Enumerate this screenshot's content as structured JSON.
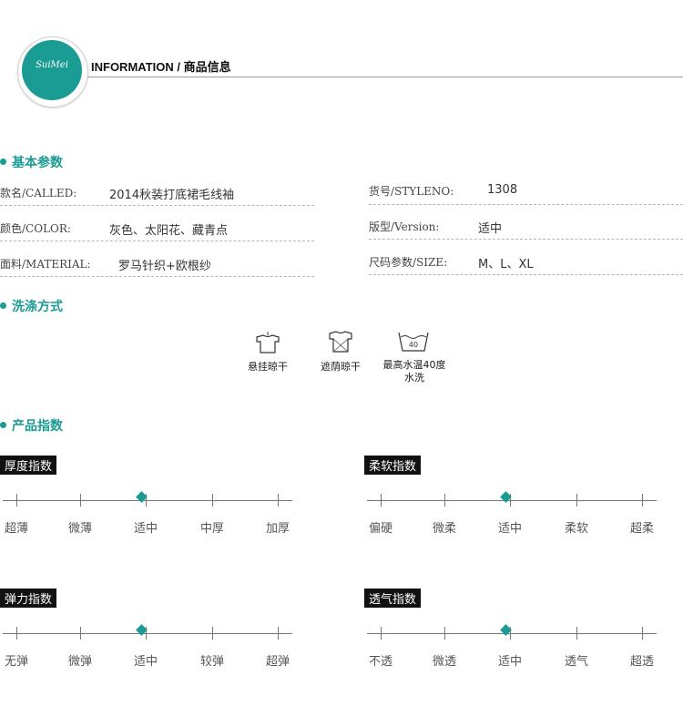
{
  "header": {
    "logo_text": "SuiMei",
    "title": "INFORMATION / 商品信息"
  },
  "sections": {
    "basic": "基本参数",
    "wash": "洗涤方式",
    "index": "产品指数"
  },
  "params": [
    {
      "label": "款名/CALLED:",
      "value": "2014秋装打底裙毛线袖"
    },
    {
      "label": "颜色/COLOR:",
      "value": "灰色、太阳花、藏青点"
    },
    {
      "label": "面料/MATERIAL:",
      "value": "罗马针织+欧根纱"
    },
    {
      "label": "货号/STYLENO:",
      "value": "1308"
    },
    {
      "label": "版型/Version:",
      "value": "适中"
    },
    {
      "label": "尺码参数/SIZE:",
      "value": "M、L、XL"
    }
  ],
  "wash": [
    {
      "icon": "hang-dry-icon",
      "label": "悬挂晾干"
    },
    {
      "icon": "shade-dry-icon",
      "label": "遮荫晾干"
    },
    {
      "icon": "wash-40-icon",
      "label": "最高水温40度\n水洗",
      "temp": "40"
    }
  ],
  "scales": [
    {
      "title": "厚度指数",
      "ticks": [
        "超薄",
        "微薄",
        "适中",
        "中厚",
        "加厚"
      ],
      "selected": 2
    },
    {
      "title": "柔软指数",
      "ticks": [
        "偏硬",
        "微柔",
        "适中",
        "柔软",
        "超柔"
      ],
      "selected": 2
    },
    {
      "title": "弹力指数",
      "ticks": [
        "无弹",
        "微弹",
        "适中",
        "较弹",
        "超弹"
      ],
      "selected": 2
    },
    {
      "title": "透气指数",
      "ticks": [
        "不透",
        "微透",
        "适中",
        "透气",
        "超透"
      ],
      "selected": 2
    }
  ],
  "colors": {
    "accent": "#1a9b93",
    "tag_bg": "#111111"
  }
}
